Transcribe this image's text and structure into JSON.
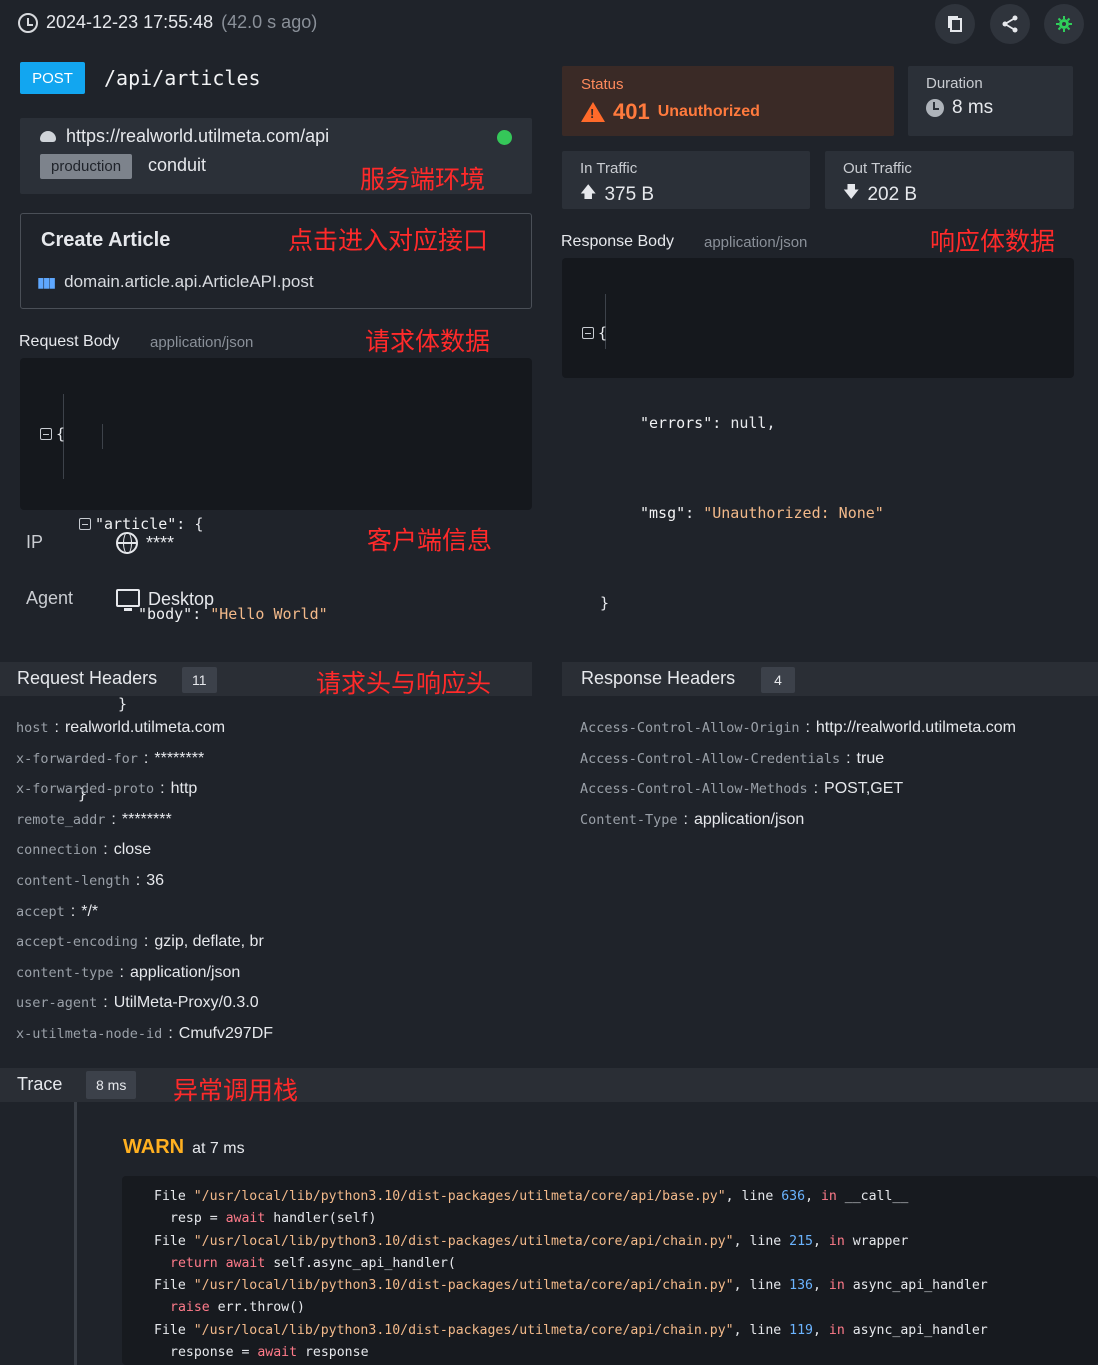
{
  "top": {
    "timestamp": "2024-12-23 17:55:48",
    "ago": "(42.0 s ago)",
    "actions": [
      "copy-icon",
      "share-icon",
      "settings-icon"
    ]
  },
  "request": {
    "method": "POST",
    "path": "/api/articles"
  },
  "env": {
    "url": "https://realworld.utilmeta.com/api",
    "tag": "production",
    "name": "conduit",
    "status_color": "#35c759"
  },
  "api": {
    "title": "Create Article",
    "endpoint": "domain.article.api.ArticleAPI.post"
  },
  "request_body": {
    "label": "Request Body",
    "content_type": "application/json",
    "lines": [
      "{",
      "\"article\": {",
      "\"body\": \"Hello World\"",
      "}",
      "}"
    ],
    "key_article": "\"article\"",
    "key_body": "\"body\"",
    "val_body": "\"Hello World\""
  },
  "client": {
    "ip_label": "IP",
    "ip_value": "****",
    "agent_label": "Agent",
    "agent_value": "Desktop"
  },
  "status": {
    "label": "Status",
    "code": "401",
    "text": "Unauthorized",
    "color": "#ff7a3d"
  },
  "duration": {
    "label": "Duration",
    "value": "8 ms"
  },
  "in_traffic": {
    "label": "In Traffic",
    "value": "375 B"
  },
  "out_traffic": {
    "label": "Out Traffic",
    "value": "202 B"
  },
  "response_body": {
    "label": "Response Body",
    "content_type": "application/json",
    "key_errors": "\"errors\"",
    "val_errors": "null",
    "key_msg": "\"msg\"",
    "val_msg": "\"Unauthorized: None\""
  },
  "request_headers": {
    "title": "Request Headers",
    "count": "11",
    "items": [
      {
        "k": "host",
        "v": "realworld.utilmeta.com"
      },
      {
        "k": "x-forwarded-for",
        "v": "********"
      },
      {
        "k": "x-forwarded-proto",
        "v": "http"
      },
      {
        "k": "remote_addr",
        "v": "********"
      },
      {
        "k": "connection",
        "v": "close"
      },
      {
        "k": "content-length",
        "v": "36"
      },
      {
        "k": "accept",
        "v": "*/*"
      },
      {
        "k": "accept-encoding",
        "v": "gzip, deflate, br"
      },
      {
        "k": "content-type",
        "v": "application/json"
      },
      {
        "k": "user-agent",
        "v": "UtilMeta-Proxy/0.3.0"
      },
      {
        "k": "x-utilmeta-node-id",
        "v": "Cmufv297DF"
      }
    ]
  },
  "response_headers": {
    "title": "Response Headers",
    "count": "4",
    "items": [
      {
        "k": "Access-Control-Allow-Origin",
        "v": "http://realworld.utilmeta.com"
      },
      {
        "k": "Access-Control-Allow-Credentials",
        "v": "true"
      },
      {
        "k": "Access-Control-Allow-Methods",
        "v": "POST,GET"
      },
      {
        "k": "Content-Type",
        "v": "application/json"
      }
    ]
  },
  "trace": {
    "title": "Trace",
    "duration": "8 ms",
    "level": "WARN",
    "at": "at 7 ms",
    "frames": [
      {
        "file": "\"/usr/local/lib/python3.10/dist-packages/utilmeta/core/api/base.py\"",
        "line": "636",
        "func": "__call__",
        "code_kw": "",
        "code_pre": "resp = ",
        "code_kw2": "await",
        "code_rest": " handler(self)"
      },
      {
        "file": "\"/usr/local/lib/python3.10/dist-packages/utilmeta/core/api/chain.py\"",
        "line": "215",
        "func": "wrapper",
        "code_kw": "return await",
        "code_pre": "",
        "code_kw2": "",
        "code_rest": " self.async_api_handler("
      },
      {
        "file": "\"/usr/local/lib/python3.10/dist-packages/utilmeta/core/api/chain.py\"",
        "line": "136",
        "func": "async_api_handler",
        "code_kw": "raise",
        "code_pre": "",
        "code_kw2": "",
        "code_rest": " err.throw()"
      },
      {
        "file": "\"/usr/local/lib/python3.10/dist-packages/utilmeta/core/api/chain.py\"",
        "line": "119",
        "func": "async_api_handler",
        "code_kw": "",
        "code_pre": "response = ",
        "code_kw2": "await",
        "code_rest": " response"
      }
    ]
  },
  "annotations": {
    "server_env": "服务端环境",
    "enter_api": "点击进入对应接口",
    "request_body": "请求体数据",
    "response_body": "响应体数据",
    "client_info": "客户端信息",
    "headers": "请求头与响应头",
    "trace": "异常调用栈"
  }
}
